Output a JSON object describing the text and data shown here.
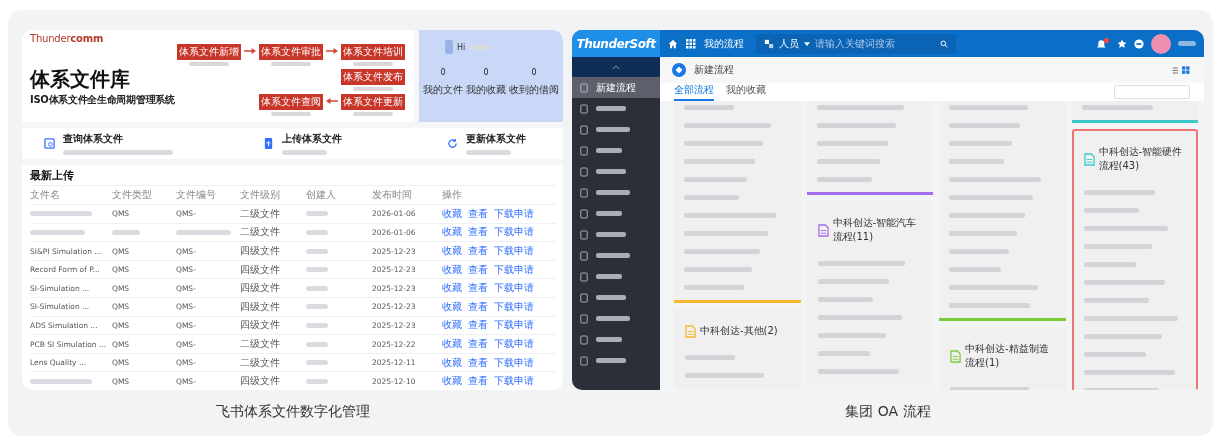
{
  "feishu_card": {
    "caption": "飞书体系文件数字化管理",
    "logo": "Thunder**comm**",
    "title": "体系文件库",
    "subtitle": "ISO体系文件全生命周期管理系统",
    "flow_steps": [
      {
        "label": "体系文件新增"
      },
      {
        "label": "体系文件审批"
      },
      {
        "label": "体系文件培训"
      },
      {
        "label": "体系文件发布"
      },
      {
        "label": "体系文件查阅"
      },
      {
        "label": "体系文件更新"
      }
    ],
    "profile": {
      "greeting": "Hi",
      "stats": [
        {
          "value": "0",
          "label": "我的文件"
        },
        {
          "value": "0",
          "label": "我的收藏"
        },
        {
          "value": "0",
          "label": "收到的借阅"
        }
      ]
    },
    "actions": [
      {
        "title": "查询体系文件"
      },
      {
        "title": "上传体系文件"
      },
      {
        "title": "更新体系文件"
      }
    ],
    "table": {
      "title": "最新上传",
      "columns": [
        "文件名",
        "文件类型",
        "文件编号",
        "文件级别",
        "创建人",
        "发布时间",
        "操作"
      ],
      "rows": [
        {
          "type": "QMS",
          "code": "QMS-",
          "level": "二级文件",
          "date": "2026-01-06",
          "actions": [
            "收藏",
            "查看",
            "下载申请"
          ]
        },
        {
          "level": "二级文件",
          "date": "2026-01-06",
          "actions": [
            "收藏",
            "查看",
            "下载申请"
          ]
        },
        {
          "name": "SI&PI Simulation ...",
          "type": "QMS",
          "code": "QMS-",
          "level": "四级文件",
          "date": "2025-12-23",
          "actions": [
            "收藏",
            "查看",
            "下载申请"
          ]
        },
        {
          "name": "Record Form of P...",
          "type": "QMS",
          "code": "QMS-",
          "level": "四级文件",
          "date": "2025-12-23",
          "actions": [
            "收藏",
            "查看",
            "下载申请"
          ]
        },
        {
          "name": "SI-Simulation ...",
          "type": "QMS",
          "code": "QMS-",
          "level": "四级文件",
          "date": "2025-12-23",
          "actions": [
            "收藏",
            "查看",
            "下载申请"
          ]
        },
        {
          "name": "SI-Simulation ...",
          "type": "QMS",
          "code": "QMS-",
          "level": "四级文件",
          "date": "2025-12-23",
          "actions": [
            "收藏",
            "查看",
            "下载申请"
          ]
        },
        {
          "name": "ADS Simulation ...",
          "type": "QMS",
          "code": "QMS-",
          "level": "四级文件",
          "date": "2025-12-23",
          "actions": [
            "收藏",
            "查看",
            "下载申请"
          ]
        },
        {
          "name": "PCB SI Simulation ...",
          "type": "QMS",
          "code": "QMS-",
          "level": "二级文件",
          "date": "2025-12-22",
          "actions": [
            "收藏",
            "查看",
            "下载申请"
          ]
        },
        {
          "name": "Lens Quality ...",
          "type": "QMS",
          "code": "QMS-",
          "level": "二级文件",
          "date": "2025-12-11",
          "actions": [
            "收藏",
            "查看",
            "下载申请"
          ]
        },
        {
          "type": "QMS",
          "code": "QMS-",
          "level": "四级文件",
          "date": "2025-12-10",
          "actions": [
            "收藏",
            "查看",
            "下载申请"
          ]
        }
      ]
    }
  },
  "oa_card": {
    "caption": "集团 OA 流程",
    "logo": "ThunderSoft",
    "nav_label": "我的流程",
    "person_menu": "人员",
    "search_placeholder": "请输入关键词搜索",
    "sidebar_items": [
      {
        "label": "新建流程",
        "selected": true
      },
      {
        "selected": false
      },
      {
        "selected": false
      },
      {
        "selected": false
      },
      {
        "selected": false
      },
      {
        "selected": false
      },
      {
        "selected": false
      },
      {
        "selected": false
      },
      {
        "selected": false
      },
      {
        "selected": false
      },
      {
        "selected": false
      },
      {
        "selected": false
      },
      {
        "selected": false
      },
      {
        "selected": false
      }
    ],
    "page_title": "新建流程",
    "tabs": [
      {
        "label": "全部流程",
        "selected": true
      },
      {
        "label": "我的收藏",
        "selected": false
      }
    ],
    "groups": [
      {
        "title": "中科创达-其他(2)",
        "color": "#f5b82e",
        "highlighted": false
      },
      {
        "title": "中科创达-智能汽车流程(11)",
        "color": "#a46cf0",
        "highlighted": false
      },
      {
        "title": "中科创达-精益制造流程(1)",
        "color": "#7ccc3a",
        "highlighted": false
      },
      {
        "title": "中科创达-智能硬件流程(43)",
        "color": "#3cc8c8",
        "highlighted": true
      }
    ]
  }
}
